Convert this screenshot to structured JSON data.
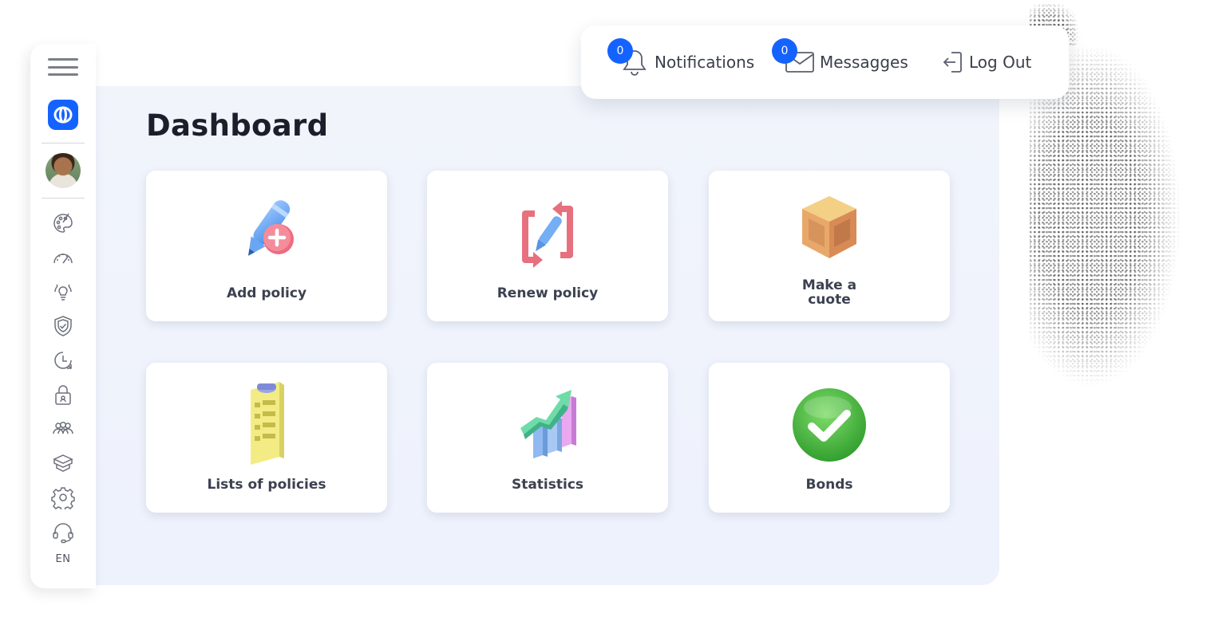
{
  "header": {
    "notifications": {
      "label": "Notifications",
      "count": "0"
    },
    "messages": {
      "label": "Messagges",
      "count": "0"
    },
    "logout": {
      "label": "Log Out"
    }
  },
  "sidebar": {
    "language": "EN",
    "icons": [
      "palette-icon",
      "speedometer-icon",
      "lightbulb-icon",
      "shield-check-icon",
      "clock-history-icon",
      "lock-icon",
      "team-icon",
      "box-icon",
      "gear-icon",
      "headset-icon"
    ]
  },
  "main": {
    "title": "Dashboard",
    "tiles": [
      {
        "label": "Add policy",
        "icon": "pencil-plus-icon"
      },
      {
        "label": "Renew policy",
        "icon": "renew-icon"
      },
      {
        "label": "Make a",
        "label2": "cuote",
        "icon": "box-icon"
      },
      {
        "label": "Lists of policies",
        "icon": "clipboard-list-icon"
      },
      {
        "label": "Statistics",
        "icon": "chart-growth-icon"
      },
      {
        "label": "Bonds",
        "icon": "check-circle-icon"
      }
    ]
  },
  "colors": {
    "accent": "#1463ff",
    "panel": "#eef2fd",
    "check": "#3cb73a"
  }
}
